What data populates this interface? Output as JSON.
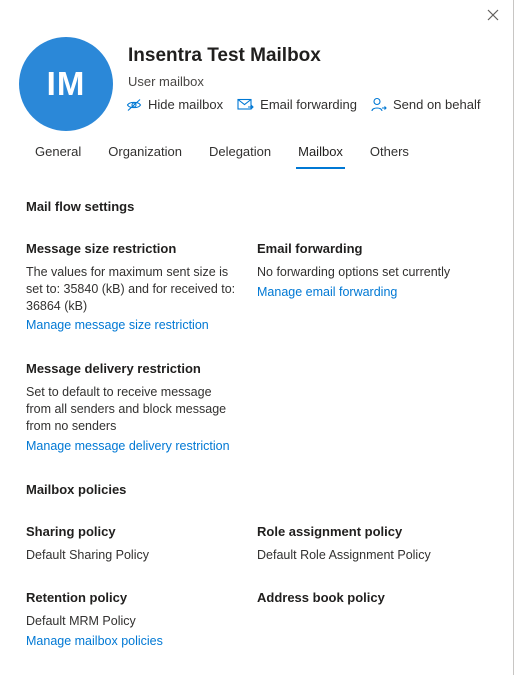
{
  "header": {
    "avatar_initials": "IM",
    "avatar_color": "#2b88d8",
    "title": "Insentra Test Mailbox",
    "subtitle": "User mailbox",
    "actions": [
      {
        "label": "Hide mailbox",
        "icon": "hide-icon"
      },
      {
        "label": "Email forwarding",
        "icon": "mail-forward-icon"
      },
      {
        "label": "Send on behalf",
        "icon": "person-icon"
      }
    ]
  },
  "tabs": [
    {
      "label": "General",
      "active": false
    },
    {
      "label": "Organization",
      "active": false
    },
    {
      "label": "Delegation",
      "active": false
    },
    {
      "label": "Mailbox",
      "active": true
    },
    {
      "label": "Others",
      "active": false
    }
  ],
  "mail_flow": {
    "heading": "Mail flow settings",
    "size_restriction": {
      "label": "Message size restriction",
      "text": "The values for maximum sent size is set to: 35840 (kB) and for received to: 36864 (kB)",
      "link": "Manage message size restriction"
    },
    "email_forwarding": {
      "label": "Email forwarding",
      "text": "No forwarding options set currently",
      "link": "Manage email forwarding"
    },
    "delivery_restriction": {
      "label": "Message delivery restriction",
      "text": "Set to default to receive message from all senders and block message from no senders",
      "link": "Manage message delivery restriction"
    }
  },
  "policies": {
    "heading": "Mailbox policies",
    "sharing": {
      "label": "Sharing policy",
      "value": "Default Sharing Policy"
    },
    "role_assignment": {
      "label": "Role assignment policy",
      "value": "Default Role Assignment Policy"
    },
    "retention": {
      "label": "Retention policy",
      "value": "Default MRM Policy"
    },
    "address_book": {
      "label": "Address book policy",
      "value": ""
    },
    "link": "Manage mailbox policies"
  },
  "colors": {
    "accent": "#0078d4",
    "text": "#323130"
  }
}
